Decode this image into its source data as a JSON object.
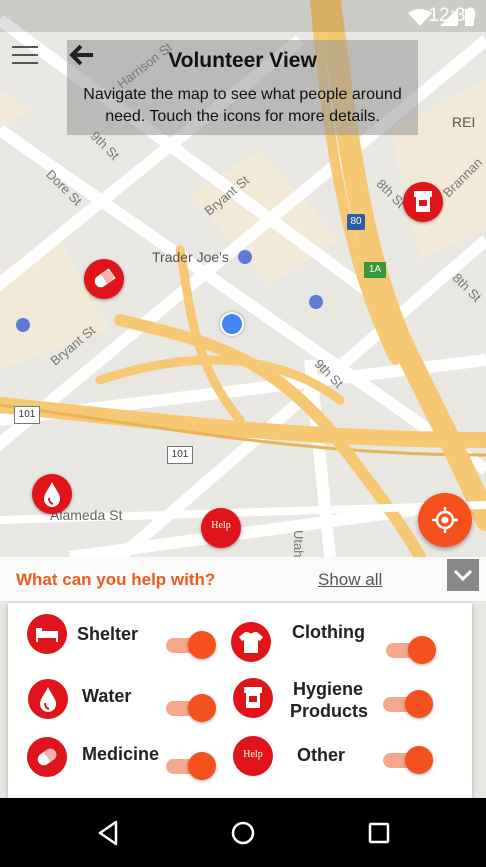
{
  "status_bar": {
    "time": "12:30"
  },
  "header": {
    "title": "Volunteer View",
    "subtitle": "Navigate the map to see what people around need. Touch the icons for more details."
  },
  "map": {
    "labels": {
      "harrison": "Harrison St",
      "ninth_top": "9th St",
      "dore": "Dore St",
      "bryant_top": "Bryant St",
      "traders": "Trader Joe's",
      "rei": "REI",
      "eighth": "8th St",
      "brannan": "Brannan",
      "i80": "80",
      "exit": "1A",
      "bryant_left": "Bryant St",
      "ninth_mid": "9th St",
      "eighth_right": "8th St",
      "us101_left": "101",
      "us101_mid": "101",
      "alameda": "Alameda St",
      "utah": "Utah St"
    },
    "pins": {
      "help_label": "Help"
    }
  },
  "panel": {
    "title": "What can you help with?",
    "show_all": "Show all",
    "items": [
      {
        "label": "Shelter",
        "icon": "bed-icon",
        "enabled": true
      },
      {
        "label": "Clothing",
        "icon": "shirt-icon",
        "enabled": true
      },
      {
        "label": "Water",
        "icon": "water-drop-icon",
        "enabled": true
      },
      {
        "label": "Hygiene Products",
        "label_line1": "Hygiene",
        "label_line2": "Products",
        "icon": "hygiene-icon",
        "enabled": true
      },
      {
        "label": "Medicine",
        "icon": "pill-icon",
        "enabled": true
      },
      {
        "label": "Other",
        "icon": "help-icon",
        "help_text": "Help",
        "enabled": true
      }
    ]
  },
  "colors": {
    "accent": "#f4511e",
    "pin_red": "#e0141b",
    "title_orange": "#ef5a1c",
    "highway": "#f7c873",
    "map_bg": "#e9e7e2"
  }
}
